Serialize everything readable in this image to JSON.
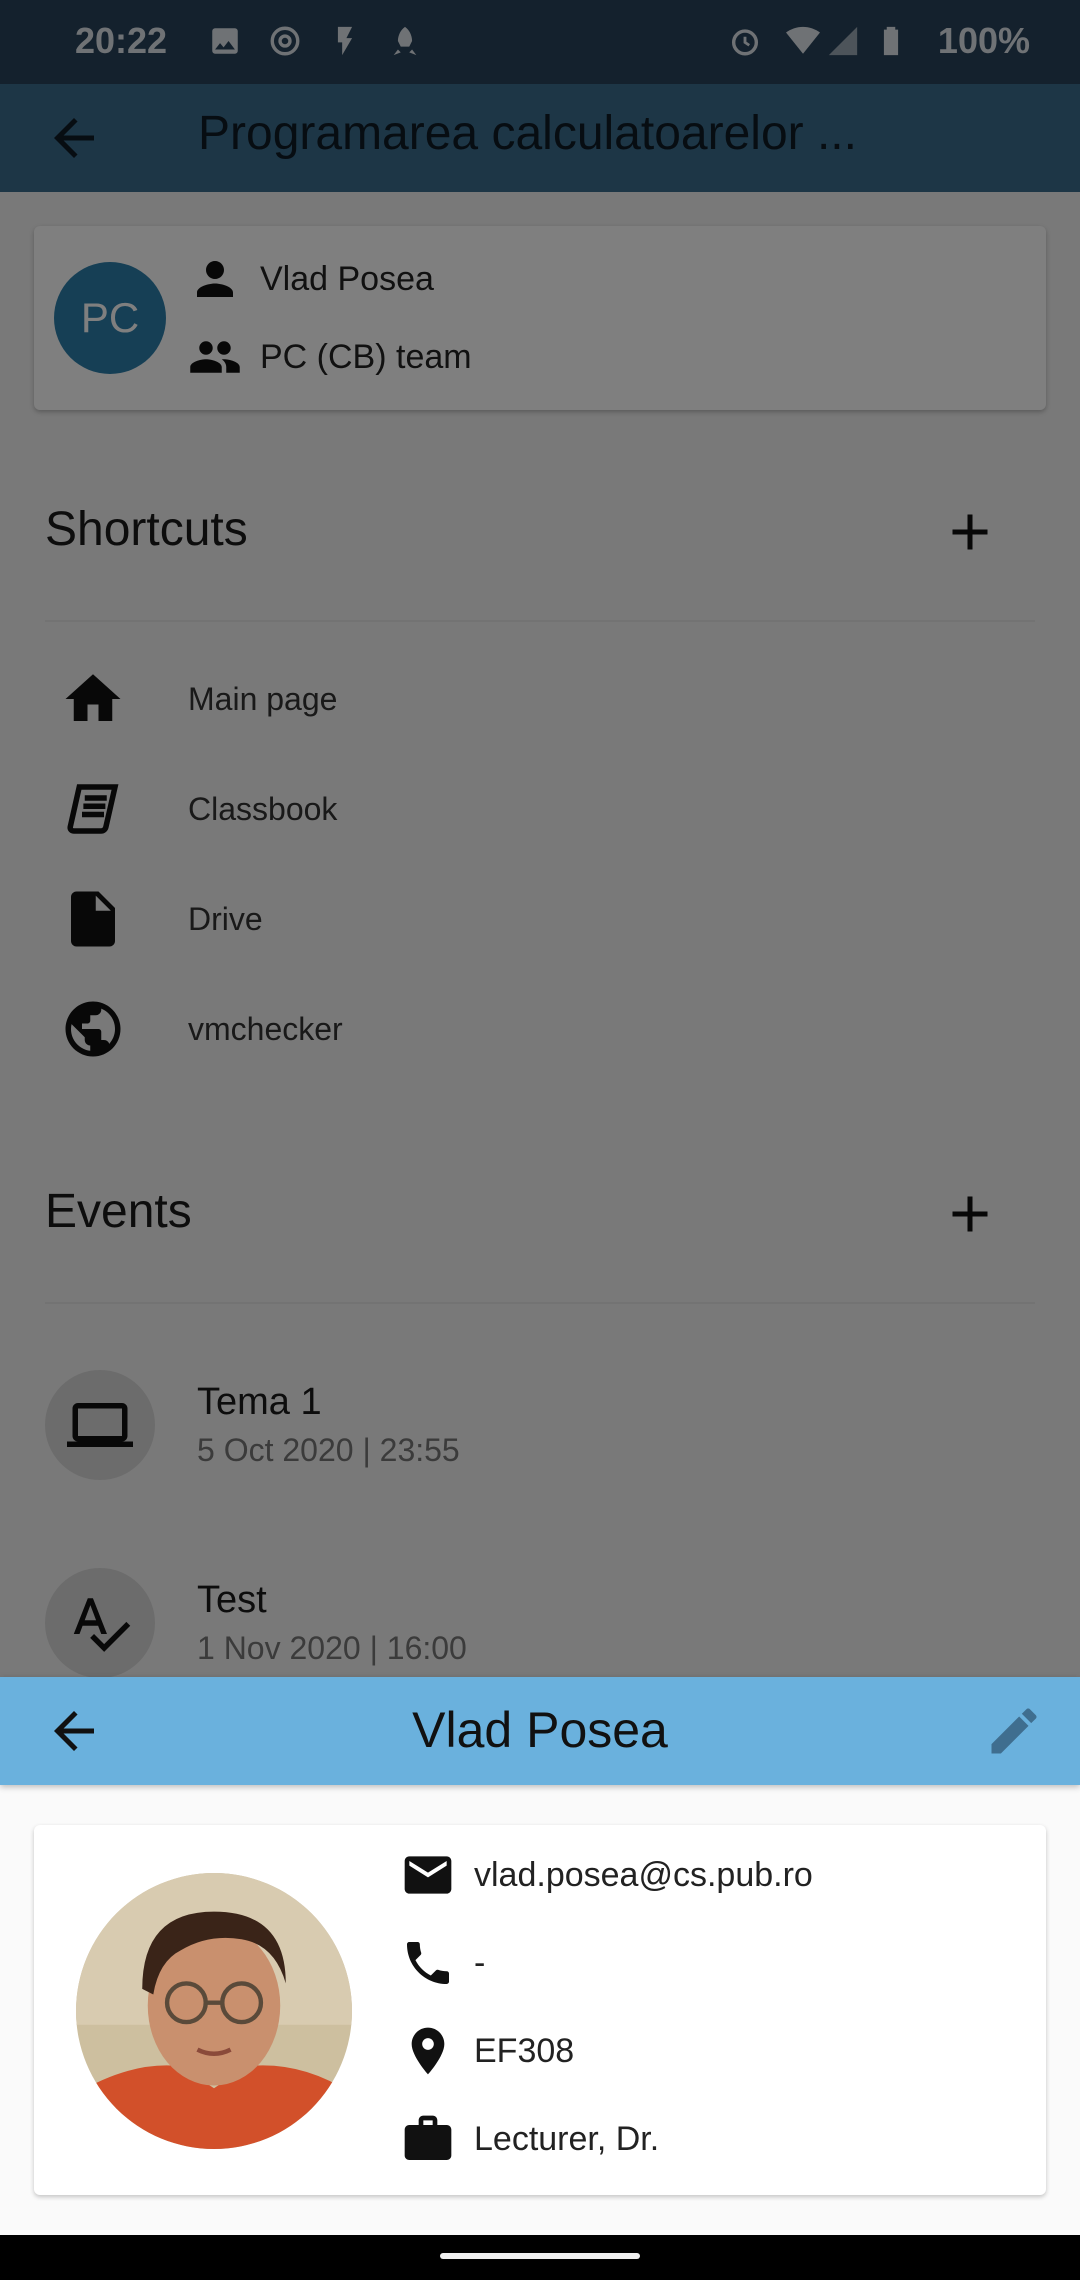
{
  "status_bar": {
    "time": "20:22",
    "battery": "100%"
  },
  "app_bar": {
    "title": "Programarea calculatoarelor ..."
  },
  "course_card": {
    "avatar_initials": "PC",
    "lecturer": "Vlad Posea",
    "team": "PC (CB) team"
  },
  "shortcuts": {
    "title": "Shortcuts",
    "items": [
      {
        "label": "Main page",
        "icon": "home-icon"
      },
      {
        "label": "Classbook",
        "icon": "book-icon"
      },
      {
        "label": "Drive",
        "icon": "file-icon"
      },
      {
        "label": "vmchecker",
        "icon": "globe-icon"
      }
    ]
  },
  "events": {
    "title": "Events",
    "items": [
      {
        "title": "Tema 1",
        "date": "5 Oct 2020 | 23:55",
        "icon": "laptop-icon"
      },
      {
        "title": "Test",
        "date": "1 Nov 2020 | 16:00",
        "icon": "spellcheck-icon"
      }
    ]
  },
  "sheet": {
    "title": "Vlad Posea",
    "email": "vlad.posea@cs.pub.ro",
    "phone": "-",
    "office": "EF308",
    "position": "Lecturer, Dr."
  },
  "colors": {
    "status_bar": "#28425a",
    "app_bar": "#3b6c8d",
    "sheet_bar": "#6ab1dd",
    "avatar": "#2c7fab"
  }
}
